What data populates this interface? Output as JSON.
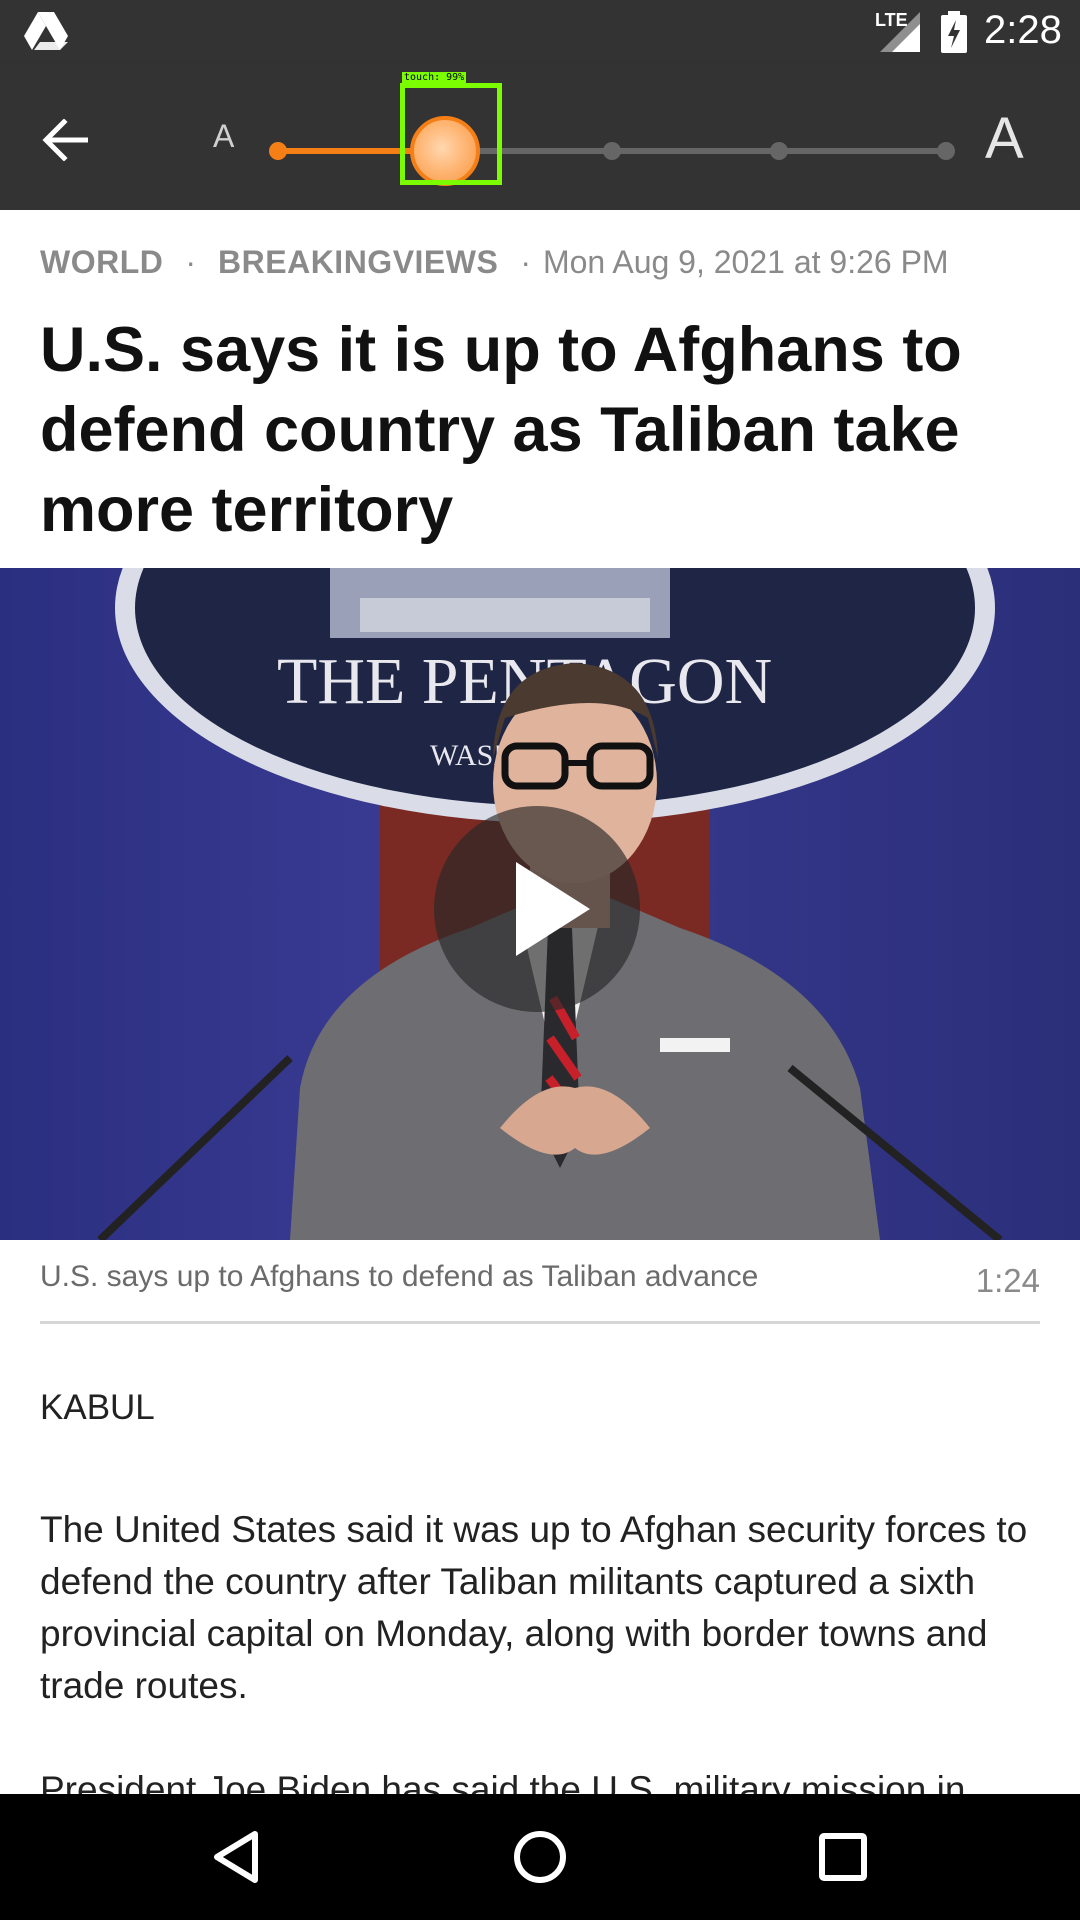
{
  "status_bar": {
    "network": "LTE",
    "time": "2:28",
    "icons": [
      "google-drive-icon",
      "signal-icon",
      "battery-charging-icon"
    ]
  },
  "toolbar": {
    "back_icon": "arrow-back-icon",
    "font_small_label": "A",
    "font_large_label": "A",
    "font_size_slider": {
      "steps": 5,
      "selected_index": 1,
      "accent": "#f57f17"
    },
    "touch_label": "touch: 99%",
    "touch_color": "#7cfc00"
  },
  "article": {
    "category": "WORLD",
    "section": "BREAKINGVIEWS",
    "separator": "·",
    "timestamp": "Mon Aug 9, 2021 at 9:26 PM",
    "headline": "U.S. says it is up to Afghans to defend country as Taliban take more territory",
    "video": {
      "caption": "U.S. says up to Afghans to defend as Taliban advance",
      "duration": "1:24",
      "seal_text_1": "THE PENTAGON",
      "seal_text_2": "WASHINGTON",
      "play_icon": "play-icon"
    },
    "dateline": "KABUL",
    "paragraphs": [
      "The United States said it was up to Afghan security forces to defend the country after Taliban militants captured a sixth provincial capital on Monday, along with border towns and trade routes.",
      "President Joe Biden has said the U.S. military mission in"
    ]
  },
  "nav_bar": {
    "buttons": [
      "back-triangle-icon",
      "home-circle-icon",
      "recents-square-icon"
    ]
  }
}
